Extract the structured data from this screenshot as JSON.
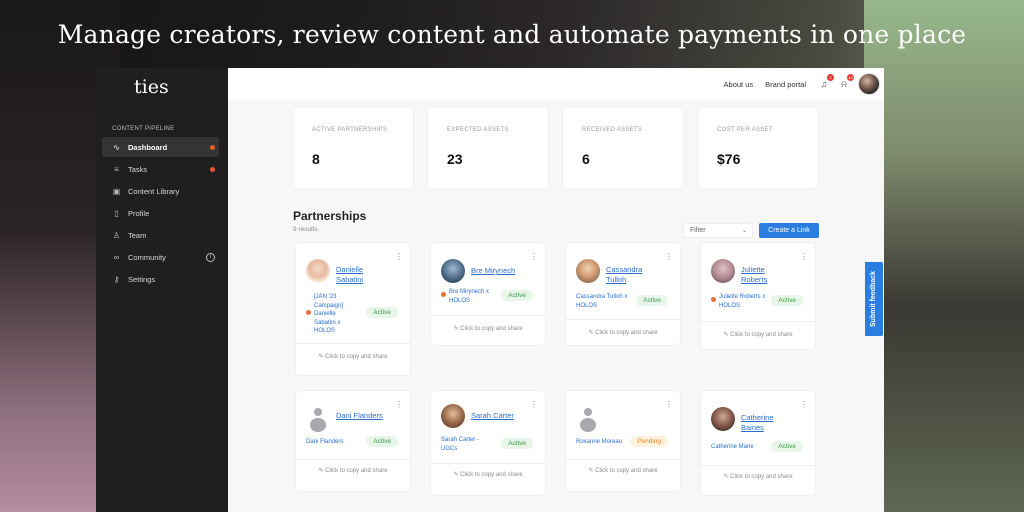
{
  "headline": "Manage creators, review content and automate payments in one place",
  "sidebar": {
    "logo": "ties",
    "section_label": "CONTENT PIPELINE",
    "items": [
      {
        "label": "Dashboard",
        "icon": "activity-icon",
        "glyph": "∿"
      },
      {
        "label": "Tasks",
        "icon": "list-icon",
        "glyph": "≡"
      },
      {
        "label": "Content Library",
        "icon": "image-icon",
        "glyph": "▣"
      },
      {
        "label": "Profile",
        "icon": "document-icon",
        "glyph": "▯"
      },
      {
        "label": "Team",
        "icon": "user-icon",
        "glyph": "♙"
      },
      {
        "label": "Community",
        "icon": "link-icon",
        "glyph": "∞",
        "info": "i"
      },
      {
        "label": "Settings",
        "icon": "key-icon",
        "glyph": "⚷"
      }
    ]
  },
  "topbar": {
    "about": "About us",
    "brand_portal": "Brand portal",
    "notif_count_1": "3",
    "notif_count_2": "10"
  },
  "stats": [
    {
      "label": "ACTIVE PARTNERSHIPS",
      "value": "8"
    },
    {
      "label": "EXPECTED ASSETS",
      "value": "23"
    },
    {
      "label": "RECEIVED ASSETS",
      "value": "6"
    },
    {
      "label": "COST PER ASSET",
      "value": "$76"
    }
  ],
  "partnerships": {
    "title": "Partnerships",
    "results": "9 results",
    "filter_label": "Filter",
    "create_label": "Create a Link",
    "copy_label": "✎ Click to copy and share",
    "cards": [
      {
        "name": "Danielle Sabatini",
        "sub": "[JAN '23 Campaign] Danielle Sabatini x HOLOS",
        "status": "Active"
      },
      {
        "name": "Bre Mirynech",
        "sub": "Bre Mirynech x HOLOS",
        "status": "Active"
      },
      {
        "name": "Cassandra Tulloh",
        "sub": "Cassandra Tulloh x HOLOS",
        "status": "Active"
      },
      {
        "name": "Juliette Roberts",
        "sub": "Juliette Roberts x HOLOS",
        "status": "Active"
      },
      {
        "name": "Dani Flanders",
        "sub": "Dani Flanders",
        "status": "Active"
      },
      {
        "name": "Sarah Carter",
        "sub": "Sarah Carter - UGCs",
        "status": "Active"
      },
      {
        "name": "",
        "sub": "Roxanne Moreau",
        "status": "Pending"
      },
      {
        "name": "Catherine Baines",
        "sub": "Catherine Marie",
        "status": "Active"
      }
    ]
  },
  "feedback_label": "Submit feedback"
}
